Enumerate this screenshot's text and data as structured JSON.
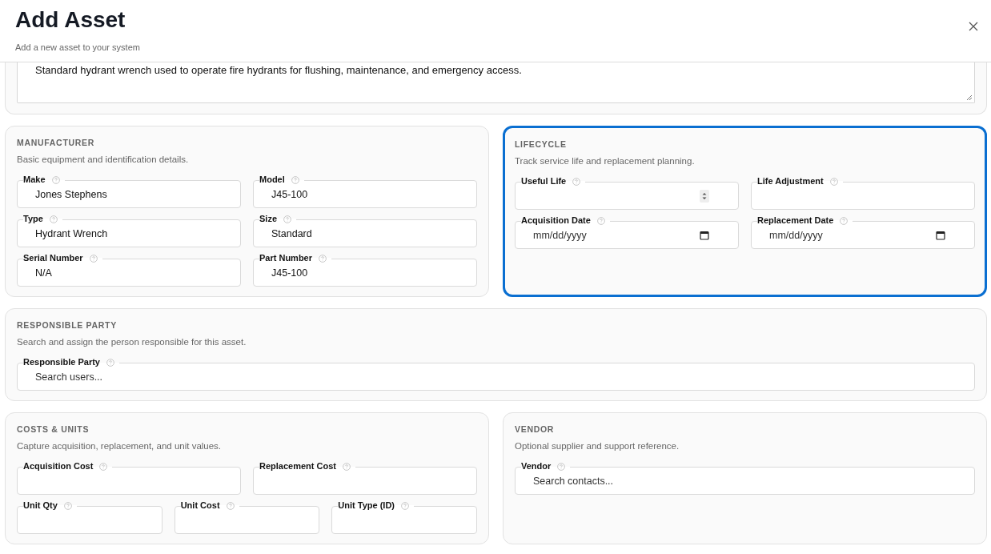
{
  "header": {
    "title": "Add Asset",
    "subtitle": "Add a new asset to your system"
  },
  "description": {
    "value": "Standard hydrant wrench used to operate fire hydrants for flushing, maintenance, and emergency access."
  },
  "section_rows": [
    [
      {
        "title": "MANUFACTURER",
        "subtitle": "Basic equipment and identification details.",
        "focused": false,
        "field_rows": [
          [
            {
              "label": "Make",
              "kind": "text",
              "value": "Jones Stephens"
            },
            {
              "label": "Model",
              "kind": "text",
              "value": "J45-100"
            }
          ],
          [
            {
              "label": "Type",
              "kind": "text",
              "value": "Hydrant Wrench"
            },
            {
              "label": "Size",
              "kind": "text",
              "value": "Standard"
            }
          ],
          [
            {
              "label": "Serial Number",
              "kind": "text",
              "value": "N/A"
            },
            {
              "label": "Part Number",
              "kind": "text",
              "value": "J45-100"
            }
          ]
        ]
      },
      {
        "title": "LIFECYCLE",
        "subtitle": "Track service life and replacement planning.",
        "focused": true,
        "field_rows": [
          [
            {
              "label": "Useful Life",
              "kind": "number"
            },
            {
              "label": "Life Adjustment",
              "kind": "text"
            }
          ],
          [
            {
              "label": "Acquisition Date",
              "kind": "date",
              "placeholder": "mm/dd/yyyy"
            },
            {
              "label": "Replacement Date",
              "kind": "date",
              "placeholder": "mm/dd/yyyy"
            }
          ]
        ]
      }
    ],
    [
      {
        "title": "RESPONSIBLE PARTY",
        "subtitle": "Search and assign the person responsible for this asset.",
        "focused": false,
        "field_rows": [
          [
            {
              "label": "Responsible Party",
              "kind": "text",
              "placeholder": "Search users..."
            }
          ]
        ]
      }
    ],
    [
      {
        "title": "COSTS & UNITS",
        "subtitle": "Capture acquisition, replacement, and unit values.",
        "focused": false,
        "field_rows": [
          [
            {
              "label": "Acquisition Cost",
              "kind": "text"
            },
            {
              "label": "Replacement Cost",
              "kind": "text"
            }
          ],
          [
            {
              "label": "Unit Qty",
              "kind": "text"
            },
            {
              "label": "Unit Cost",
              "kind": "text"
            },
            {
              "label": "Unit Type (ID)",
              "kind": "text"
            }
          ]
        ]
      },
      {
        "title": "VENDOR",
        "subtitle": "Optional supplier and support reference.",
        "focused": false,
        "field_rows": [
          [
            {
              "label": "Vendor",
              "kind": "text",
              "placeholder": "Search contacts..."
            }
          ]
        ]
      }
    ]
  ]
}
